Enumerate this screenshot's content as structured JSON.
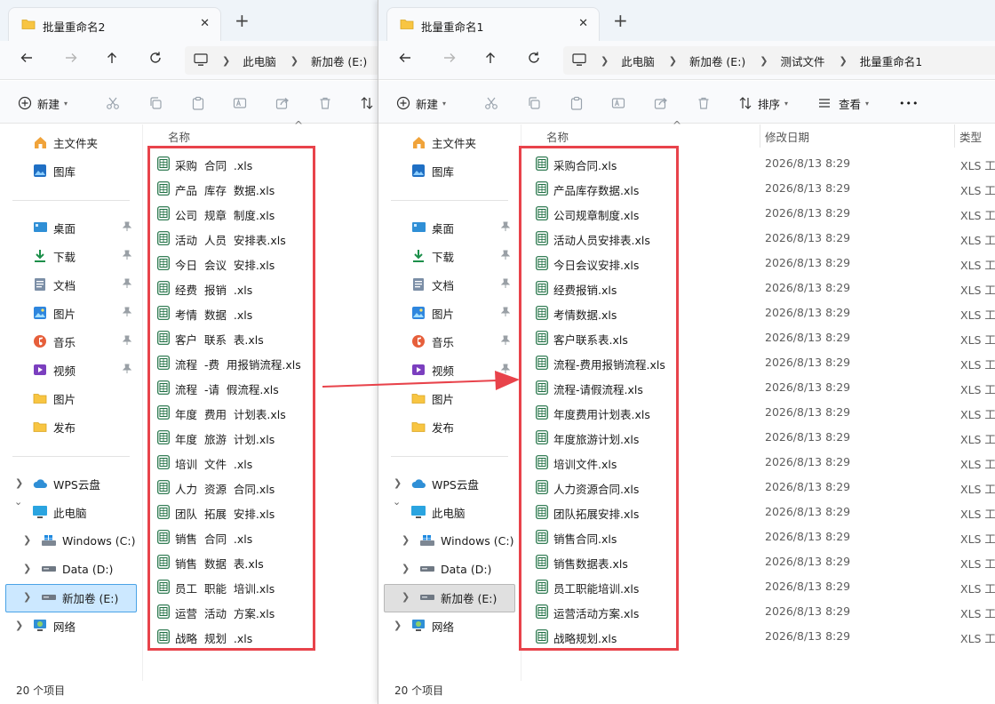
{
  "left_window": {
    "tab_title": "批量重命名2",
    "breadcrumbs": [
      "此电脑",
      "新加卷 (E:)"
    ],
    "toolbar": {
      "new_label": "新建"
    },
    "column_name": "名称",
    "files": [
      "采购  合同  .xls",
      "产品  库存  数据.xls",
      "公司  规章  制度.xls",
      "活动  人员  安排表.xls",
      "今日  会议  安排.xls",
      "经费  报销  .xls",
      "考情  数据  .xls",
      "客户  联系  表.xls",
      "流程  -费  用报销流程.xls",
      "流程  -请  假流程.xls",
      "年度  费用  计划表.xls",
      "年度  旅游  计划.xls",
      "培训  文件  .xls",
      "人力  资源  合同.xls",
      "团队  拓展  安排.xls",
      "销售  合同  .xls",
      "销售  数据  表.xls",
      "员工  职能  培训.xls",
      "运营  活动  方案.xls",
      "战略  规划  .xls"
    ],
    "status": "20 个项目",
    "selected_drive": "新加卷 (E:)",
    "selection_color": "#cce8ff"
  },
  "right_window": {
    "tab_title": "批量重命名1",
    "breadcrumbs": [
      "此电脑",
      "新加卷 (E:)",
      "测试文件",
      "批量重命名1"
    ],
    "toolbar": {
      "new_label": "新建",
      "sort_label": "排序",
      "view_label": "查看",
      "more_label": "•••"
    },
    "columns": {
      "name": "名称",
      "date": "修改日期",
      "type": "类型"
    },
    "files": [
      "采购合同.xls",
      "产品库存数据.xls",
      "公司规章制度.xls",
      "活动人员安排表.xls",
      "今日会议安排.xls",
      "经费报销.xls",
      "考情数据.xls",
      "客户联系表.xls",
      "流程-费用报销流程.xls",
      "流程-请假流程.xls",
      "年度费用计划表.xls",
      "年度旅游计划.xls",
      "培训文件.xls",
      "人力资源合同.xls",
      "团队拓展安排.xls",
      "销售合同.xls",
      "销售数据表.xls",
      "员工职能培训.xls",
      "运营活动方案.xls",
      "战略规划.xls"
    ],
    "file_date": "2026/8/13 8:29",
    "file_type": "XLS 工作表",
    "status": "20 个项目",
    "selected_drive": "新加卷 (E:)",
    "selection_color": "#e0e0e0"
  },
  "sidebar": {
    "home": "主文件夹",
    "gallery": "图库",
    "quick": [
      {
        "label": "桌面",
        "icon": "desktop-icon"
      },
      {
        "label": "下载",
        "icon": "download-icon"
      },
      {
        "label": "文档",
        "icon": "document-icon"
      },
      {
        "label": "图片",
        "icon": "pictures-icon"
      },
      {
        "label": "音乐",
        "icon": "music-icon"
      },
      {
        "label": "视频",
        "icon": "video-icon"
      },
      {
        "label": "图片",
        "icon": "folder-icon"
      },
      {
        "label": "发布",
        "icon": "folder-icon"
      }
    ],
    "wps": "WPS云盘",
    "pc": "此电脑",
    "drives": [
      "Windows (C:)",
      "Data (D:)",
      "新加卷 (E:)"
    ],
    "network": "网络"
  },
  "colors": {
    "highlight": "#e8434b",
    "folder": "#f8c542",
    "excel": "#1d6f42"
  }
}
